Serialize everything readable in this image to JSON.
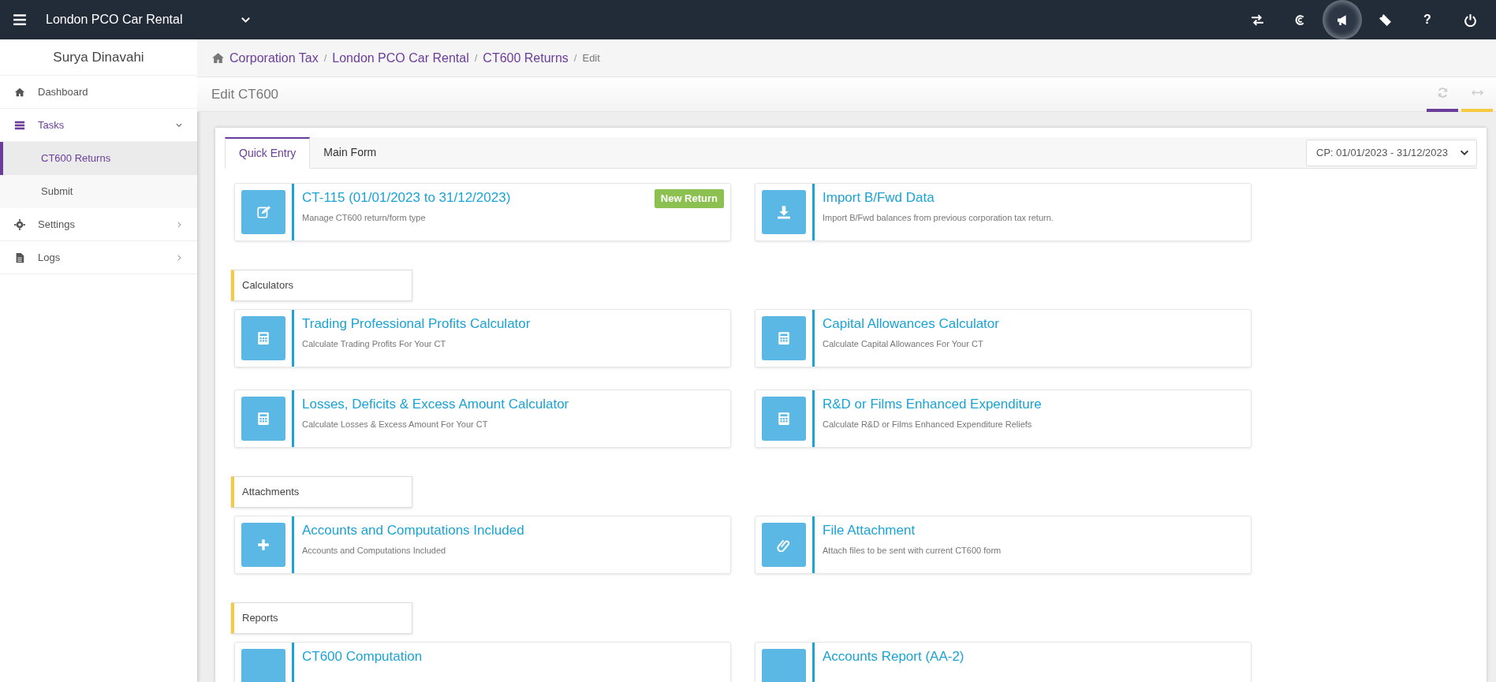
{
  "topbar": {
    "title": "London PCO Car Rental",
    "help_label": "?"
  },
  "sidebar": {
    "user_name": "Surya Dinavahi",
    "items": [
      {
        "label": "Dashboard",
        "selected": false
      },
      {
        "label": "Tasks",
        "selected": true,
        "expanded": true,
        "children": [
          {
            "label": "CT600 Returns",
            "selected": true
          },
          {
            "label": "Submit",
            "selected": false
          }
        ]
      },
      {
        "label": "Settings",
        "selected": false,
        "expanded": false
      },
      {
        "label": "Logs",
        "selected": false,
        "expanded": false
      }
    ]
  },
  "breadcrumb_separator": "/",
  "breadcrumbs": [
    {
      "label": "Corporation Tax",
      "current": false
    },
    {
      "label": "London PCO Car Rental",
      "current": false
    },
    {
      "label": "CT600 Returns",
      "current": false
    },
    {
      "label": "Edit",
      "current": true
    }
  ],
  "page_title": "Edit CT600",
  "tabs": [
    {
      "label": "Quick Entry",
      "selected": true
    },
    {
      "label": "Main Form",
      "selected": false
    }
  ],
  "period_select": "CP: 01/01/2023 - 31/12/2023",
  "sections": [
    {
      "tiles": [
        {
          "title": "CT-115 (01/01/2023 to 31/12/2023)",
          "description": "Manage CT600 return/form type",
          "badge": "New Return"
        },
        {
          "title": "Import B/Fwd Data",
          "description": "Import B/Fwd balances from previous corporation tax return."
        }
      ]
    },
    {
      "heading": "Calculators",
      "tiles": [
        {
          "title": "Trading Professional Profits Calculator",
          "description": "Calculate Trading Profits For Your CT"
        },
        {
          "title": "Capital Allowances Calculator",
          "description": "Calculate Capital Allowances For Your CT"
        },
        {
          "title": "Losses, Deficits & Excess Amount Calculator",
          "description": "Calculate Losses & Excess Amount For Your CT"
        },
        {
          "title": "R&D or Films Enhanced Expenditure",
          "description": "Calculate R&D or Films Enhanced Expenditure Reliefs"
        }
      ]
    },
    {
      "heading": "Attachments",
      "tiles": [
        {
          "title": "Accounts and Computations Included",
          "description": "Accounts and Computations Included"
        },
        {
          "title": "File Attachment",
          "description": "Attach files to be sent with current CT600 form"
        }
      ]
    },
    {
      "heading": "Reports",
      "tiles": [
        {
          "title": "CT600 Computation"
        },
        {
          "title": "Accounts Report (AA-2)"
        }
      ]
    }
  ]
}
